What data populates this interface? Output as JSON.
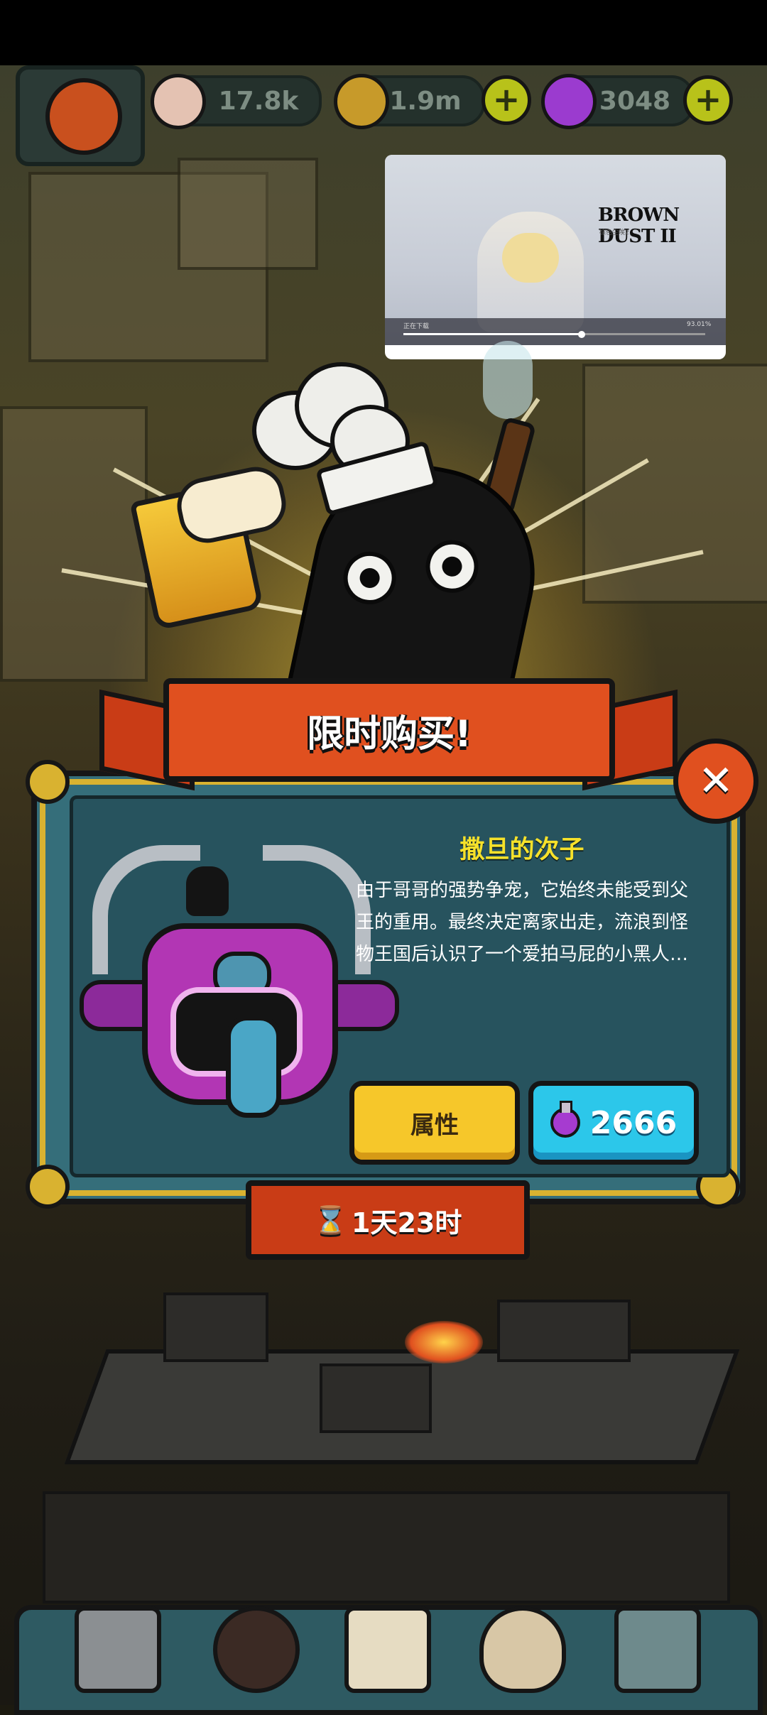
{
  "hud": {
    "eyeballs": "17.8k",
    "coins": "1.9m",
    "potions": "3048",
    "plus_label": "+"
  },
  "video": {
    "logo": "BROWN DUST II",
    "subtitle": "棕色尘埃2",
    "time_left": "正在下载",
    "time_right": "93.01%",
    "progress": 0.59
  },
  "dialog": {
    "title": "限时购买!",
    "close_label": "✕",
    "character_name": "撒旦的次子",
    "description": "由于哥哥的强势争宠，它始终未能受到父王的重用。最终决定离家出走，流浪到怪物王国后认识了一个爱拍马屁的小黑人…",
    "attributes_button": "属性",
    "price": "2666",
    "timer_icon": "⌛",
    "timer": "1天23时"
  },
  "colors": {
    "ribbon": "#e0501f",
    "panel": "#356e7a",
    "gold": "#d9b230",
    "name": "#f6e12a",
    "buy_button": "#2cc7ea",
    "attr_button": "#f6c72a"
  },
  "icons": [
    "avatar-icon",
    "eyeball-icon",
    "coin-icon",
    "potion-icon",
    "close-icon",
    "hourglass-icon",
    "kitchen-icon",
    "monster-icon",
    "book-icon",
    "bag-icon",
    "grid-icon"
  ]
}
